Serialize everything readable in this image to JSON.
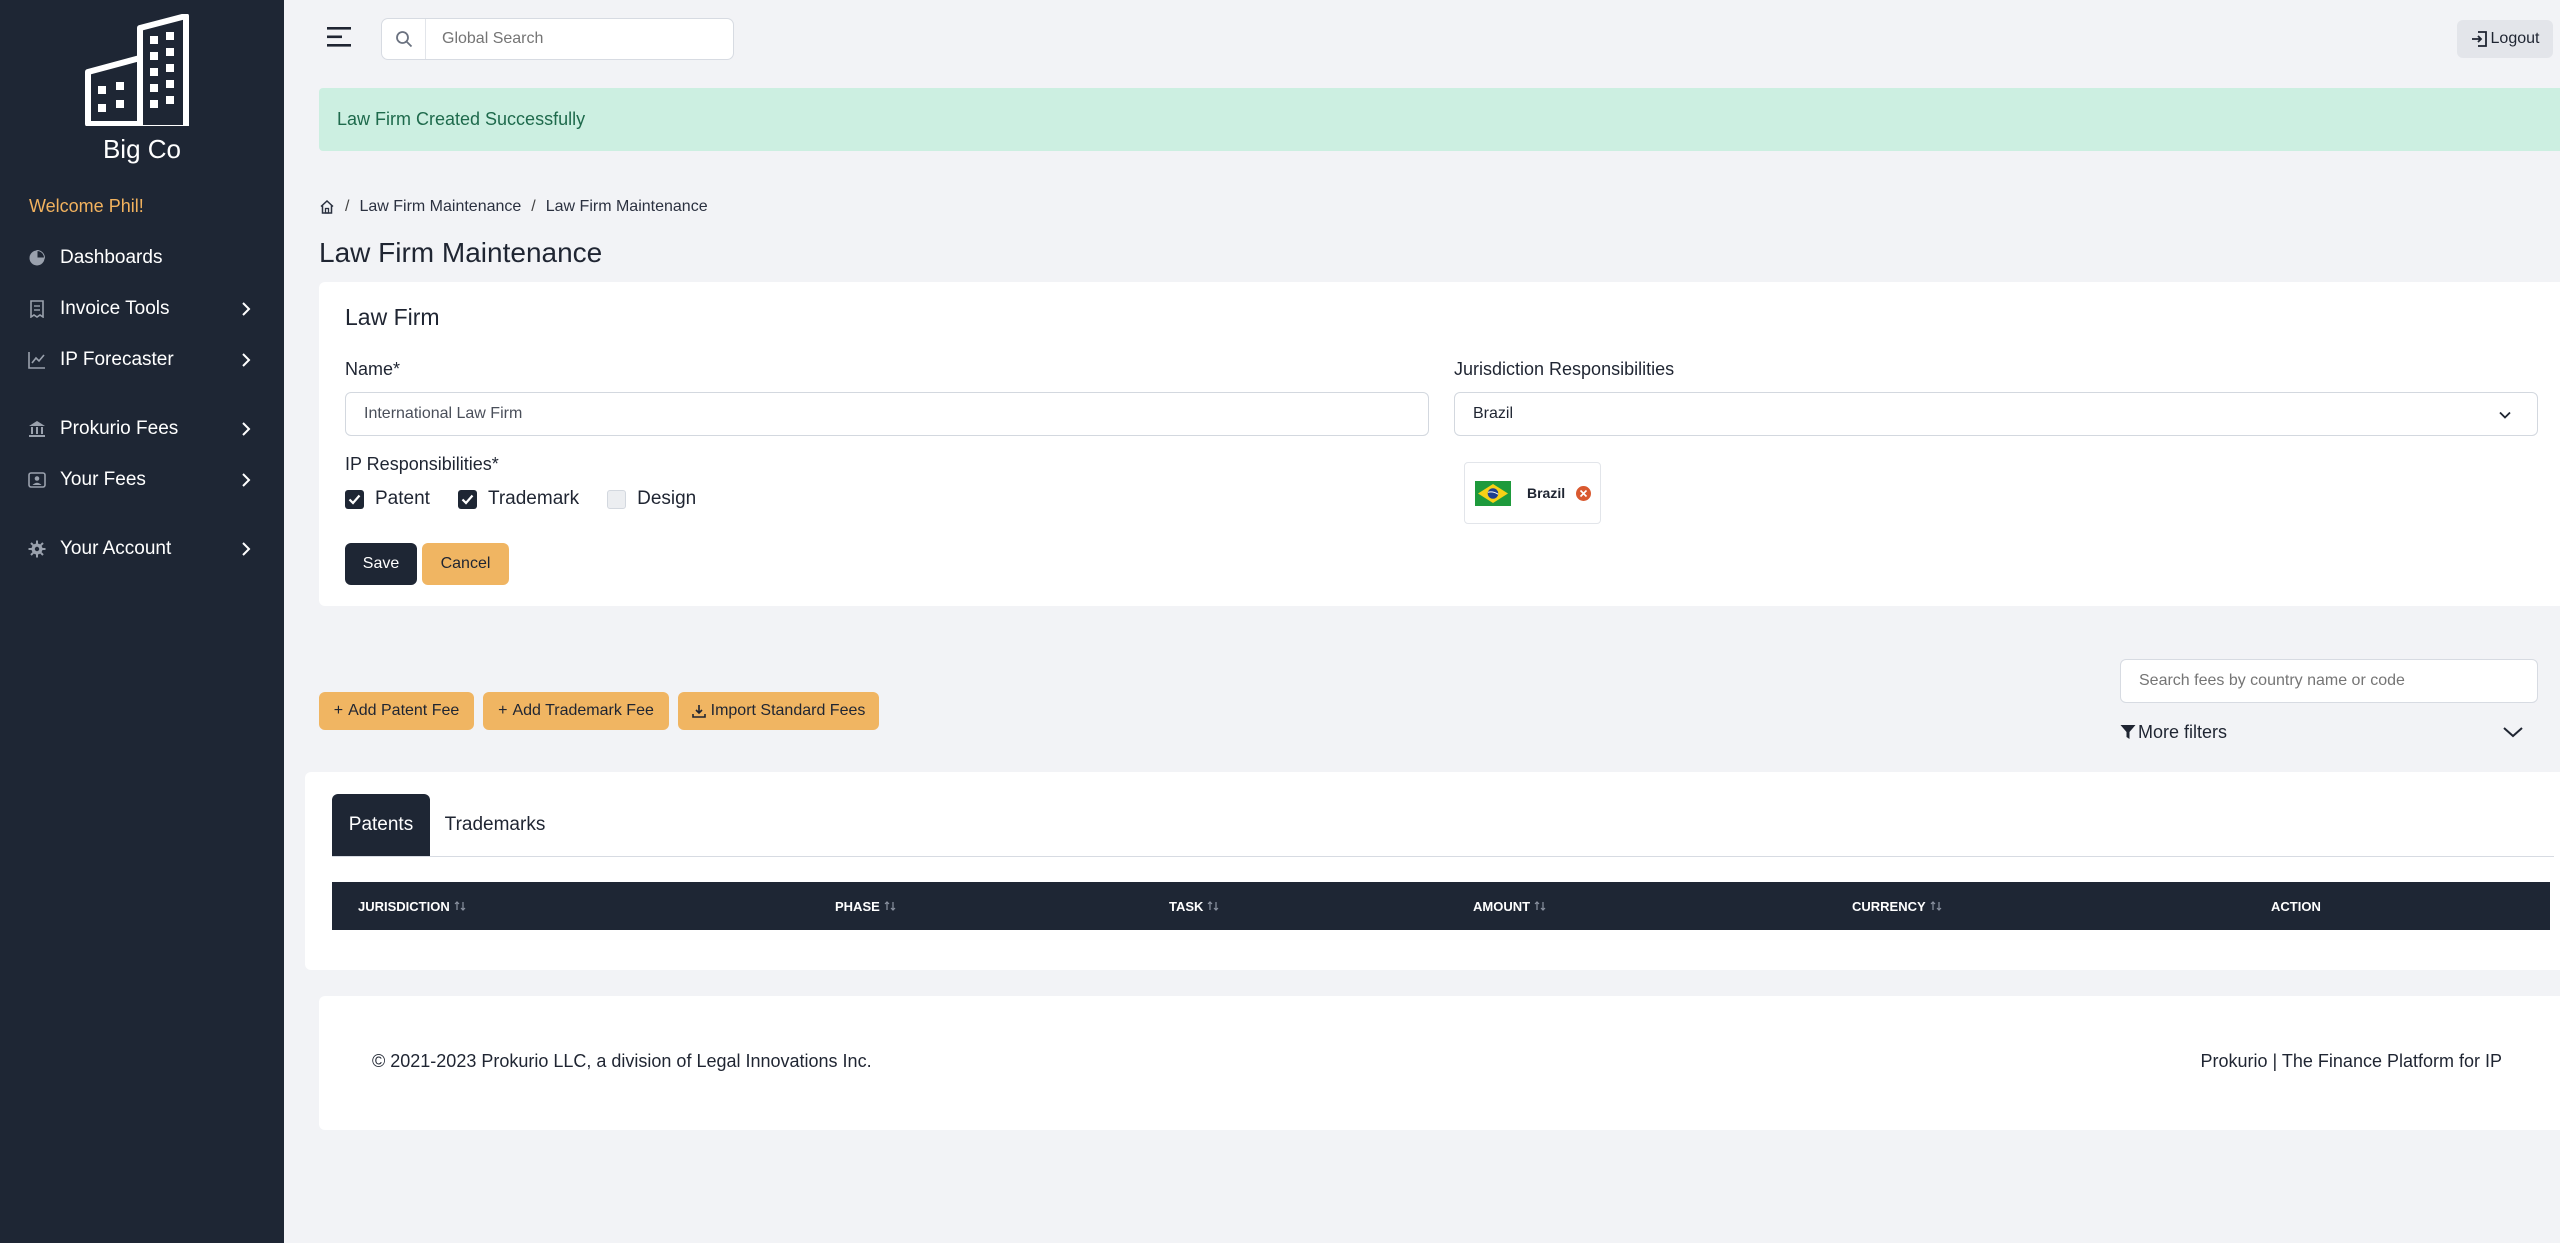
{
  "sidebar": {
    "brand": "Big Co",
    "welcome": "Welcome Phil!",
    "items": [
      {
        "label": "Dashboards",
        "icon": "pie-chart-icon"
      },
      {
        "label": "Invoice Tools",
        "icon": "receipt-icon"
      },
      {
        "label": "IP Forecaster",
        "icon": "trend-chart-icon"
      },
      {
        "label": "Prokurio Fees",
        "icon": "bank-icon"
      },
      {
        "label": "Your Fees",
        "icon": "id-card-icon"
      },
      {
        "label": "Your Account",
        "icon": "gear-icon"
      }
    ]
  },
  "topbar": {
    "search_placeholder": "Global Search",
    "logout_label": "Logout"
  },
  "alert": {
    "message": "Law Firm Created Successfully",
    "color": "#ccefe1"
  },
  "breadcrumb": {
    "items": [
      "Law Firm Maintenance",
      "Law Firm Maintenance"
    ]
  },
  "page_title": "Law Firm Maintenance",
  "form": {
    "title": "Law Firm",
    "name_label": "Name*",
    "name_value": "International Law Firm",
    "jurisdiction_label": "Jurisdiction Responsibilities",
    "jurisdiction_selected": "Brazil",
    "ip_label": "IP Responsibilities*",
    "ip_options": [
      {
        "label": "Patent",
        "checked": true
      },
      {
        "label": "Trademark",
        "checked": true
      },
      {
        "label": "Design",
        "checked": false
      }
    ],
    "save_label": "Save",
    "cancel_label": "Cancel",
    "selected_country": "Brazil"
  },
  "fees": {
    "add_patent_label": "Add Patent Fee",
    "add_trademark_label": "Add Trademark Fee",
    "import_label": "Import Standard Fees",
    "search_placeholder": "Search fees by country name or code",
    "more_filters_label": "More filters"
  },
  "tabs": [
    "Patents",
    "Trademarks"
  ],
  "table": {
    "columns": [
      "JURISDICTION",
      "PHASE",
      "TASK",
      "AMOUNT",
      "CURRENCY",
      "ACTION"
    ]
  },
  "footer": {
    "copyright": "© 2021-2023 Prokurio LLC, a division of Legal Innovations Inc.",
    "tagline": "Prokurio | The Finance Platform for IP"
  },
  "colors": {
    "sidebar": "#1e2634",
    "accent": "#f0b562",
    "welcome": "#f2b25e"
  }
}
